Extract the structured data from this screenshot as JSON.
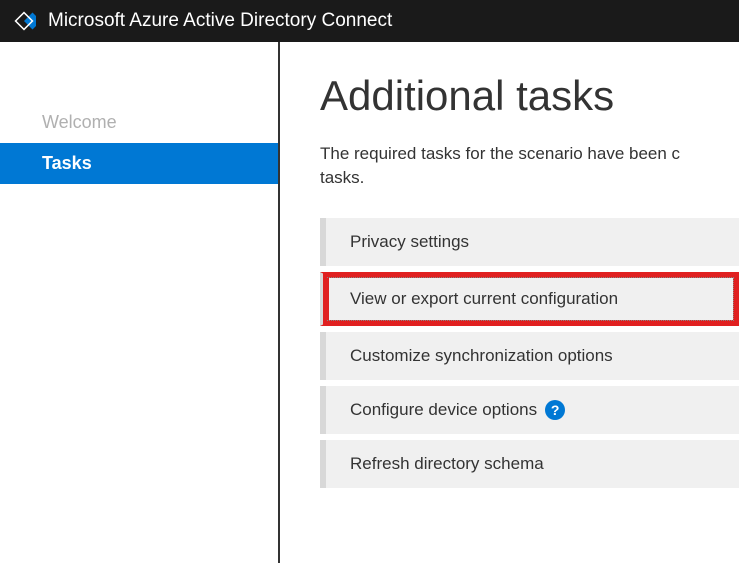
{
  "titlebar": {
    "title": "Microsoft Azure Active Directory Connect"
  },
  "sidebar": {
    "items": [
      {
        "label": "Welcome",
        "active": false
      },
      {
        "label": "Tasks",
        "active": true
      }
    ]
  },
  "main": {
    "heading": "Additional tasks",
    "description_line1": "The required tasks for the scenario have been c",
    "description_line2": "tasks.",
    "tasks": [
      {
        "label": "Privacy settings",
        "highlighted": false,
        "help": false
      },
      {
        "label": "View or export current configuration",
        "highlighted": true,
        "help": false
      },
      {
        "label": "Customize synchronization options",
        "highlighted": false,
        "help": false
      },
      {
        "label": "Configure device options",
        "highlighted": false,
        "help": true
      },
      {
        "label": "Refresh directory schema",
        "highlighted": false,
        "help": false
      }
    ]
  },
  "icons": {
    "help_glyph": "?"
  }
}
